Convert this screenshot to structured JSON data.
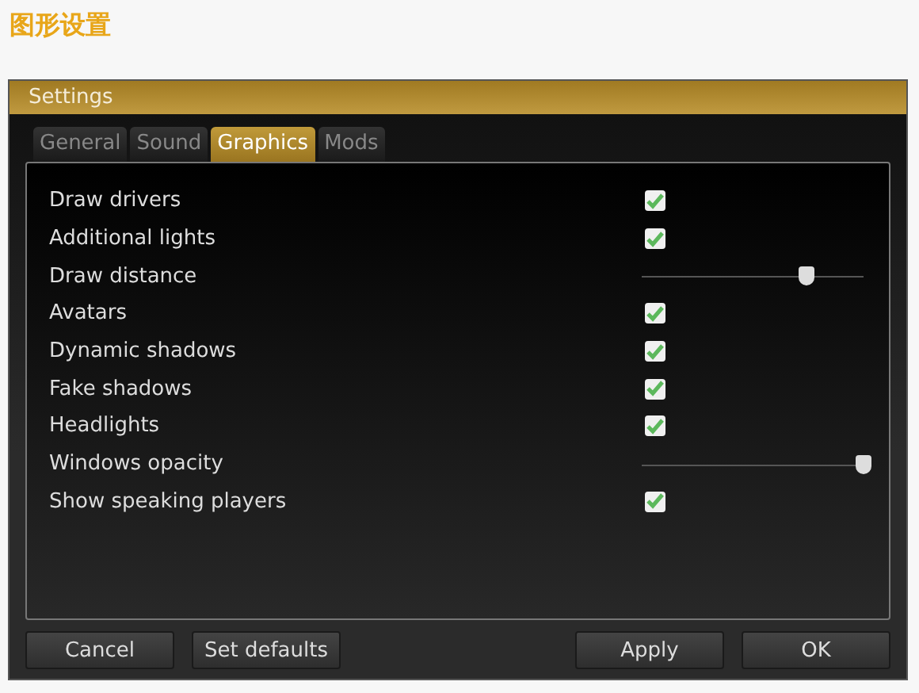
{
  "heading": "图形设置",
  "window": {
    "title": "Settings"
  },
  "tabs": [
    {
      "label": "General",
      "selected": false
    },
    {
      "label": "Sound",
      "selected": false
    },
    {
      "label": "Graphics",
      "selected": true
    },
    {
      "label": "Mods",
      "selected": false
    }
  ],
  "options": [
    {
      "kind": "checkbox",
      "label": "Draw drivers",
      "checked": true
    },
    {
      "kind": "checkbox",
      "label": "Additional lights",
      "checked": true
    },
    {
      "kind": "slider",
      "label": "Draw distance",
      "level": 0.74
    },
    {
      "kind": "checkbox",
      "label": "Avatars",
      "checked": true
    },
    {
      "kind": "checkbox",
      "label": "Dynamic shadows",
      "checked": true
    },
    {
      "kind": "checkbox",
      "label": "Fake shadows",
      "checked": true
    },
    {
      "kind": "checkbox",
      "label": "Headlights",
      "checked": true
    },
    {
      "kind": "slider",
      "label": "Windows opacity",
      "level": 1
    },
    {
      "kind": "checkbox",
      "label": "Show speaking players",
      "checked": true
    }
  ],
  "buttons_left": [
    "Cancel",
    "Set defaults"
  ],
  "buttons_right": [
    "Apply",
    "OK"
  ]
}
